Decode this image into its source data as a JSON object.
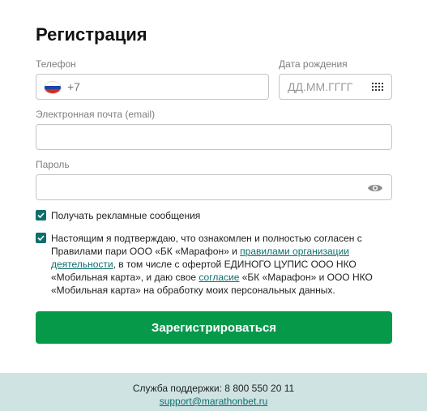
{
  "title": "Регистрация",
  "phone": {
    "label": "Телефон",
    "value": "+7",
    "flag": "russia-flag"
  },
  "birthdate": {
    "label": "Дата рождения",
    "placeholder": "ДД.ММ.ГГГГ",
    "icon": "calendar-icon"
  },
  "email": {
    "label": "Электронная почта (email)",
    "value": ""
  },
  "password": {
    "label": "Пароль",
    "value": "",
    "icon": "eye-icon"
  },
  "ads_checkbox": {
    "label": "Получать рекламные сообщения",
    "checked": true
  },
  "consent": {
    "checked": true,
    "part1": "Настоящим я подтверждаю, что ознакомлен и полностью согласен с Правилами пари ООО «БК «Марафон» и ",
    "link1": "правилами организации деятельности",
    "part2": ", в том числе с офертой ЕДИНОГО ЦУПИС ООО НКО «Мобильная карта», и даю свое ",
    "link2": "согласие",
    "part3": " «БК «Марафон» и ООО НКО «Мобильная карта» на обработку моих персональных данных."
  },
  "submit_label": "Зарегистрироваться",
  "footer": {
    "support_text": "Служба поддержки: 8 800 550 20 11",
    "email": "support@marathonbet.ru"
  },
  "colors": {
    "primary_button": "#07994a",
    "checkbox": "#0e6e6e",
    "link": "#0e6e6e",
    "footer_bg": "#cfe3e3"
  }
}
